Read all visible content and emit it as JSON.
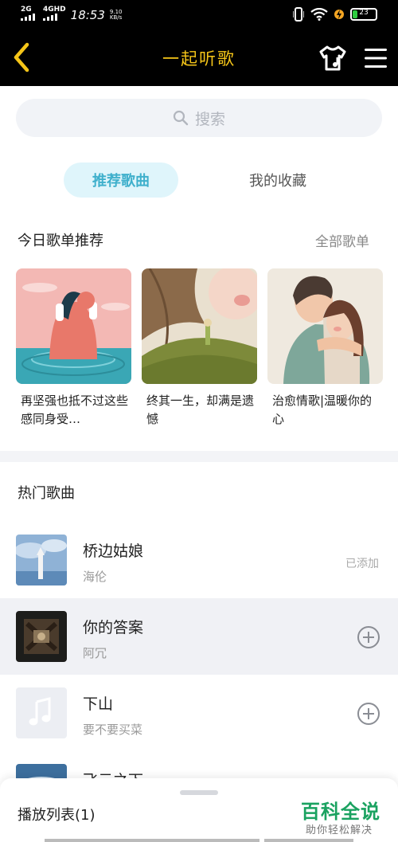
{
  "status_bar": {
    "network_1": "2G",
    "network_2": "4GHD",
    "time": "18:53",
    "speed_value": "9.10",
    "speed_unit": "KB/s",
    "battery_level": "23",
    "battery_fraction": 0.23,
    "battery_color": "#2ecc40"
  },
  "header": {
    "title": "一起听歌",
    "accent_color": "#f5c518"
  },
  "search": {
    "placeholder": "搜索"
  },
  "tabs": [
    {
      "label": "推荐歌曲",
      "active": true
    },
    {
      "label": "我的收藏",
      "active": false
    }
  ],
  "playlists_section": {
    "title": "今日歌单推荐",
    "more_label": "全部歌单",
    "items": [
      {
        "name": "再坚强也抵不过这些感同身受…"
      },
      {
        "name": "终其一生，却满是遗憾"
      },
      {
        "name": "治愈情歌|温暖你的心"
      }
    ]
  },
  "hot_songs": {
    "title": "热门歌曲",
    "songs": [
      {
        "title": "桥边姑娘",
        "artist": "海伦",
        "status": "已添加"
      },
      {
        "title": "你的答案",
        "artist": "阿冗",
        "status": ""
      },
      {
        "title": "下山",
        "artist": "要不要买菜",
        "status": ""
      },
      {
        "title": "飞云之下",
        "artist": "",
        "status": ""
      }
    ]
  },
  "playlist_sheet": {
    "label": "播放列表(1)"
  },
  "watermark": {
    "brand": "百科全说",
    "slogan": "助你轻松解决"
  }
}
